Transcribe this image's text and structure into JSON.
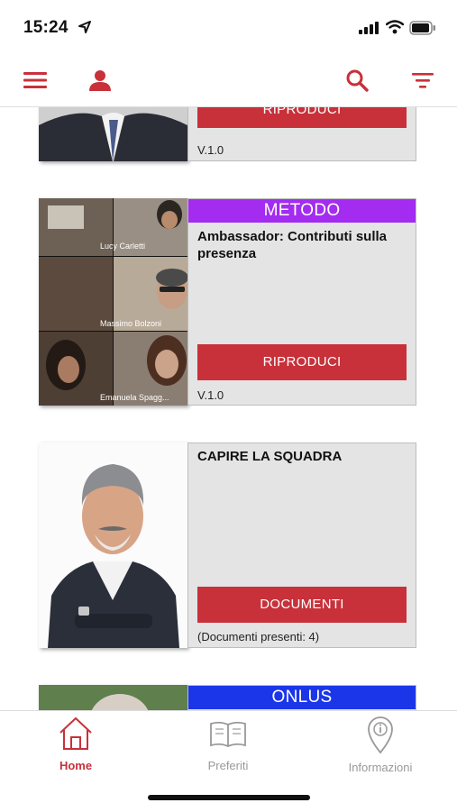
{
  "status": {
    "time": "15:24"
  },
  "nav": {
    "menu_icon": "hamburger-icon",
    "user_icon": "user-icon",
    "search_icon": "search-icon",
    "filter_icon": "filter-icon",
    "accent": "#c8313a"
  },
  "cards": [
    {
      "tag": "",
      "title": "",
      "action": "RIPRODUCI",
      "meta": "V.1.0"
    },
    {
      "tag": "METODO",
      "tag_color": "#a32cf0",
      "title": "Ambassador: Contributi sulla presenza",
      "action": "RIPRODUCI",
      "meta": "V.1.0",
      "participants": [
        "Lucy Carletti",
        "Massimo Bolzoni",
        "Emanuela Spagg..."
      ]
    },
    {
      "tag": "",
      "title": "CAPIRE LA SQUADRA",
      "action": "DOCUMENTI",
      "meta": "(Documenti presenti: 4)"
    },
    {
      "tag": "ONLUS",
      "tag_color": "#1b36e8",
      "title": "",
      "action": "",
      "meta": ""
    }
  ],
  "tabs": [
    {
      "label": "Home",
      "icon": "home-icon",
      "active": true
    },
    {
      "label": "Preferiti",
      "icon": "book-icon",
      "active": false
    },
    {
      "label": "Informazioni",
      "icon": "info-pin-icon",
      "active": false
    }
  ]
}
